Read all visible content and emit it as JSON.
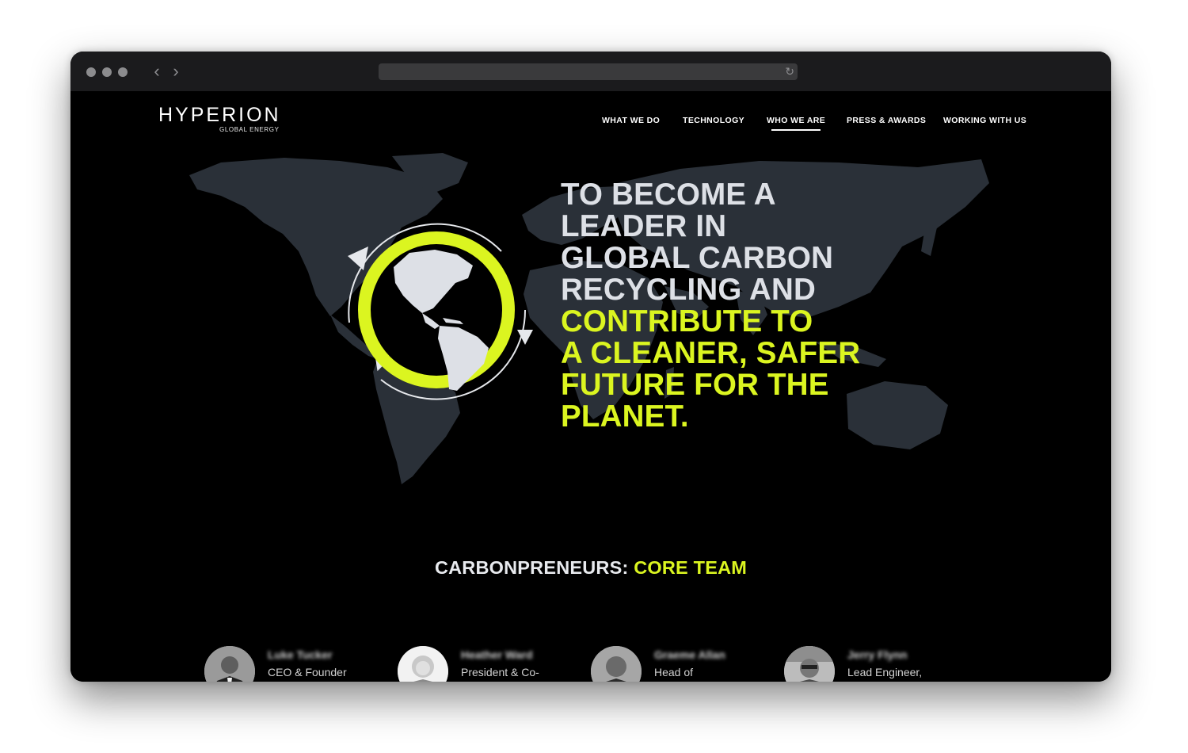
{
  "brand": {
    "name": "HYPERION",
    "tagline": "GLOBAL ENERGY"
  },
  "nav": {
    "items": [
      {
        "label": "WHAT WE DO",
        "active": false
      },
      {
        "label": "TECHNOLOGY",
        "active": false
      },
      {
        "label": "WHO WE ARE",
        "active": true
      },
      {
        "label": "PRESS & AWARDS",
        "active": false
      },
      {
        "label": "WORKING WITH US",
        "active": false
      }
    ]
  },
  "hero": {
    "lines_white": [
      "TO BECOME A",
      "LEADER IN",
      "GLOBAL CARBON",
      "RECYCLING AND"
    ],
    "lines_green": [
      "CONTRIBUTE TO",
      "A CLEANER, SAFER",
      "FUTURE FOR THE",
      "PLANET."
    ]
  },
  "team": {
    "title_white": "CARBONPRENEURS:",
    "title_green": "CORE TEAM",
    "members": [
      {
        "name": "Luke Tucker",
        "role": "CEO & Founder"
      },
      {
        "name": "Heather Ward",
        "role": "President & Co-"
      },
      {
        "name": "Graeme Allan",
        "role": "Head of"
      },
      {
        "name": "Jerry Flynn",
        "role": "Lead Engineer,"
      }
    ]
  },
  "colors": {
    "accent": "#dbf520",
    "background": "#000000",
    "map": "#2a3038",
    "text": "#dde0e6"
  },
  "icons": {
    "back": "chevron-left-icon",
    "forward": "chevron-right-icon",
    "reload": "reload-icon",
    "emblem": "globe-recycle-icon"
  }
}
